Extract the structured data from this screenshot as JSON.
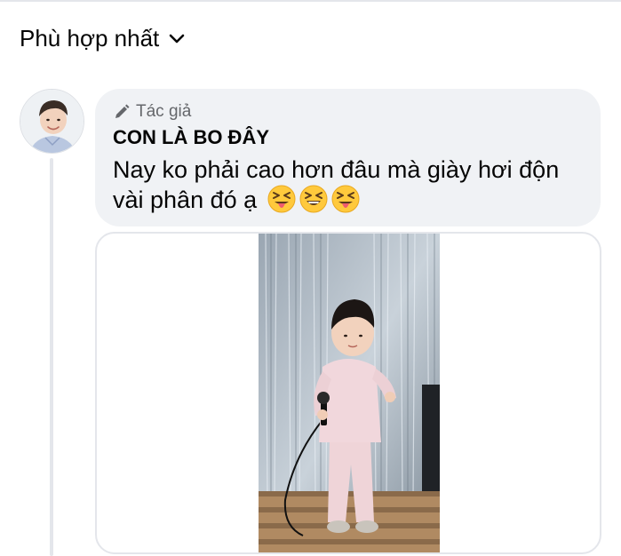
{
  "sort": {
    "label": "Phù hợp nhất",
    "icon": "chevron-down-icon"
  },
  "comment": {
    "author_badge": {
      "icon": "pencil-icon",
      "label": "Tác giả"
    },
    "author_name": "CON LÀ BO ĐÂY",
    "text": "Nay ko phải cao hơn đâu mà giày hơi độn vài phân đó ạ",
    "emojis": [
      "squinting-tongue-emoji",
      "grinning-squinting-emoji",
      "squinting-tongue-emoji"
    ]
  },
  "colors": {
    "bubble_bg": "#f0f2f5",
    "badge_text": "#65676b",
    "divider": "#e4e6eb"
  }
}
